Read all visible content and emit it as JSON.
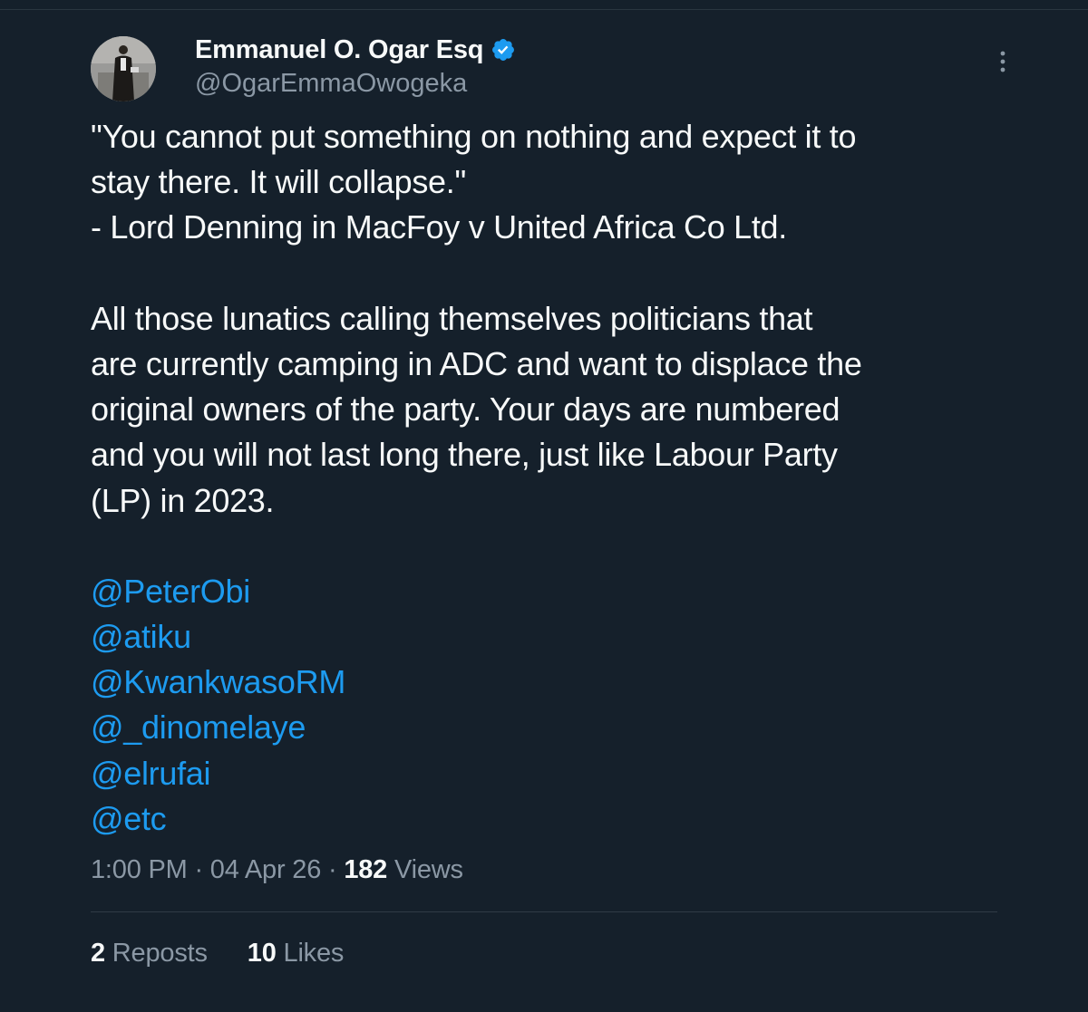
{
  "author": {
    "display_name": "Emmanuel O. Ogar Esq",
    "handle": "@OgarEmmaOwogeka",
    "verified_icon": "verified-badge-icon",
    "avatar_icon": "profile-photo"
  },
  "menu": {
    "icon": "more-vertical-icon"
  },
  "tweet": {
    "quote_lines": [
      "\"You cannot put something on nothing and expect it to",
      "stay there. It will collapse.\"",
      "- Lord Denning in MacFoy v United Africa Co Ltd."
    ],
    "body_lines": [
      "All those lunatics calling themselves politicians that",
      "are currently camping in ADC and want to displace the",
      "original owners of the party. Your days are numbered",
      "and you will not last long there, just like Labour Party",
      "(LP) in 2023."
    ],
    "mentions": [
      "@PeterObi",
      "@atiku",
      "@KwankwasoRM",
      "@_dinomelaye",
      "@elrufai",
      "@etc"
    ]
  },
  "meta": {
    "time": "1:00 PM",
    "separator": " · ",
    "date": "04 Apr 26",
    "views_count": "182",
    "views_label": "Views"
  },
  "stats": {
    "reposts_count": "2",
    "reposts_label": "Reposts",
    "likes_count": "10",
    "likes_label": "Likes"
  },
  "colors": {
    "background": "#15202b",
    "text": "#f7f9f9",
    "secondary_text": "#8b98a5",
    "link": "#1d9bf0",
    "verified": "#1d9bf0"
  }
}
